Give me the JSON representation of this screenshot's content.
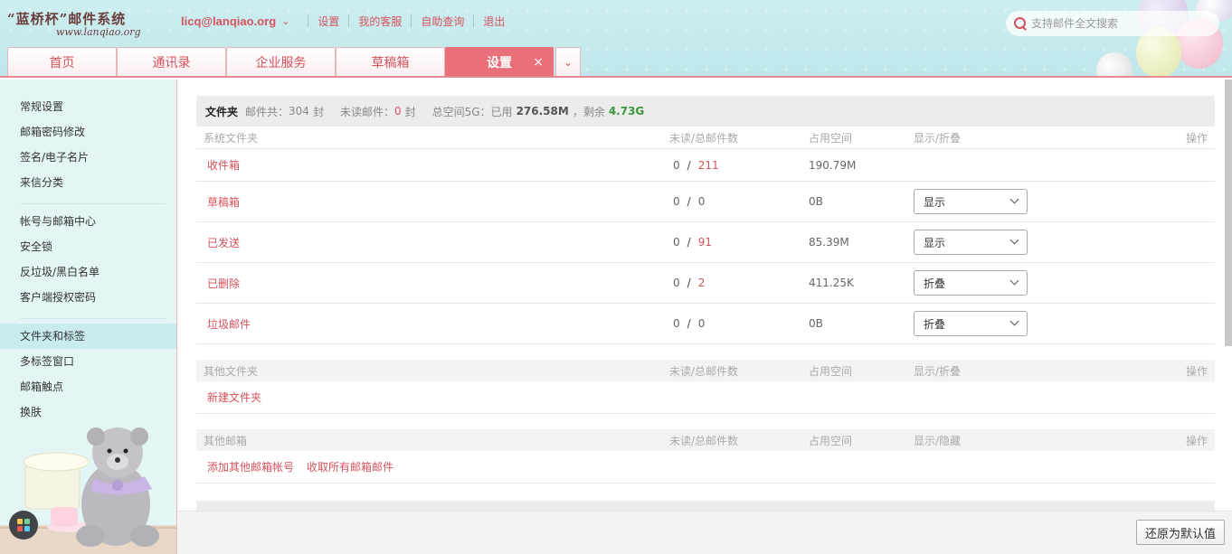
{
  "brand": {
    "title": "“蓝桥杯”邮件系统",
    "subtitle": "www.lanqiao.org"
  },
  "topnav": {
    "user": "licq@lanqiao.org",
    "links": [
      "设置",
      "我的客服",
      "自助查询",
      "退出"
    ]
  },
  "search": {
    "placeholder": "支持邮件全文搜索"
  },
  "tabs": [
    "首页",
    "通讯录",
    "企业服务",
    "草稿箱",
    "设置"
  ],
  "tab_close": "×",
  "sidebar": {
    "group1": [
      "常规设置",
      "邮箱密码修改",
      "签名/电子名片",
      "来信分类"
    ],
    "group2": [
      "帐号与邮箱中心",
      "安全锁",
      "反垃圾/黑白名单",
      "客户端授权密码"
    ],
    "group3": [
      "文件夹和标签",
      "多标签窗口",
      "邮箱触点",
      "换肤"
    ]
  },
  "summary": {
    "title": "文件夹",
    "total_label": "邮件共：",
    "total_value": "304",
    "total_unit": "封",
    "unread_label": "未读邮件：",
    "unread_value": "0",
    "unread_unit": "封",
    "space_label": "总空间5G：已用",
    "used": "276.58M",
    "remain_label": "，剩余",
    "remain": "4.73G"
  },
  "system_folders": {
    "headers": {
      "name": "系统文件夹",
      "count": "未读/总邮件数",
      "size": "占用空间",
      "display": "显示/折叠",
      "op": "操作"
    },
    "rows": [
      {
        "name": "收件箱",
        "unread": "0",
        "total": "211",
        "size": "190.79M",
        "display": ""
      },
      {
        "name": "草稿箱",
        "unread": "0",
        "total": "0",
        "size": "0B",
        "display": "显示"
      },
      {
        "name": "已发送",
        "unread": "0",
        "total": "91",
        "size": "85.39M",
        "display": "显示"
      },
      {
        "name": "已删除",
        "unread": "0",
        "total": "2",
        "size": "411.25K",
        "display": "折叠"
      },
      {
        "name": "垃圾邮件",
        "unread": "0",
        "total": "0",
        "size": "0B",
        "display": "折叠"
      }
    ]
  },
  "other_folders": {
    "headers": {
      "name": "其他文件夹",
      "count": "未读/总邮件数",
      "size": "占用空间",
      "display": "显示/折叠",
      "op": "操作"
    },
    "new_folder": "新建文件夹"
  },
  "other_mailboxes": {
    "headers": {
      "name": "其他邮箱",
      "count": "未读/总邮件数",
      "size": "占用空间",
      "display": "显示/隐藏",
      "op": "操作"
    },
    "add_account": "添加其他邮箱帐号",
    "fetch_all": "收取所有邮箱邮件"
  },
  "restore_button": "还原为默认值",
  "slash": "/"
}
